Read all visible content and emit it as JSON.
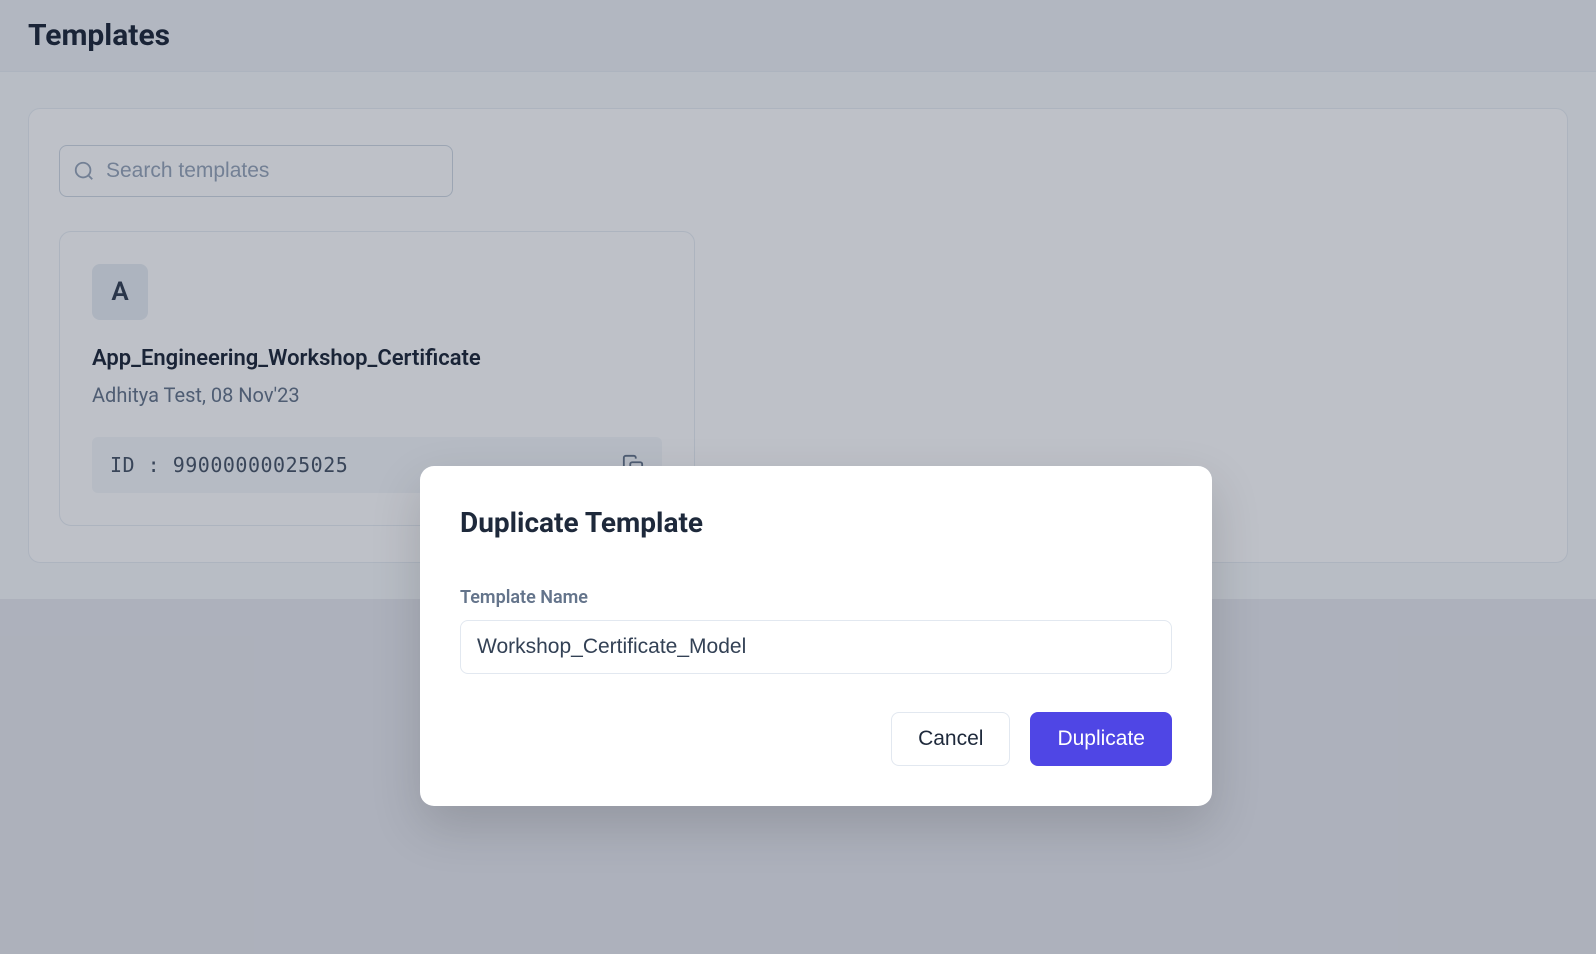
{
  "page": {
    "title": "Templates"
  },
  "search": {
    "placeholder": "Search templates"
  },
  "template": {
    "avatar_letter": "A",
    "name": "App_Engineering_Workshop_Certificate",
    "author": "Adhitya Test",
    "date": "08 Nov'23",
    "meta": "Adhitya Test, 08 Nov'23",
    "id_label": "ID : ",
    "id_value": "99000000025025",
    "id_full": "ID : 99000000025025"
  },
  "modal": {
    "title": "Duplicate Template",
    "field_label": "Template Name",
    "field_value": "Workshop_Certificate_Model",
    "cancel_label": "Cancel",
    "duplicate_label": "Duplicate"
  }
}
